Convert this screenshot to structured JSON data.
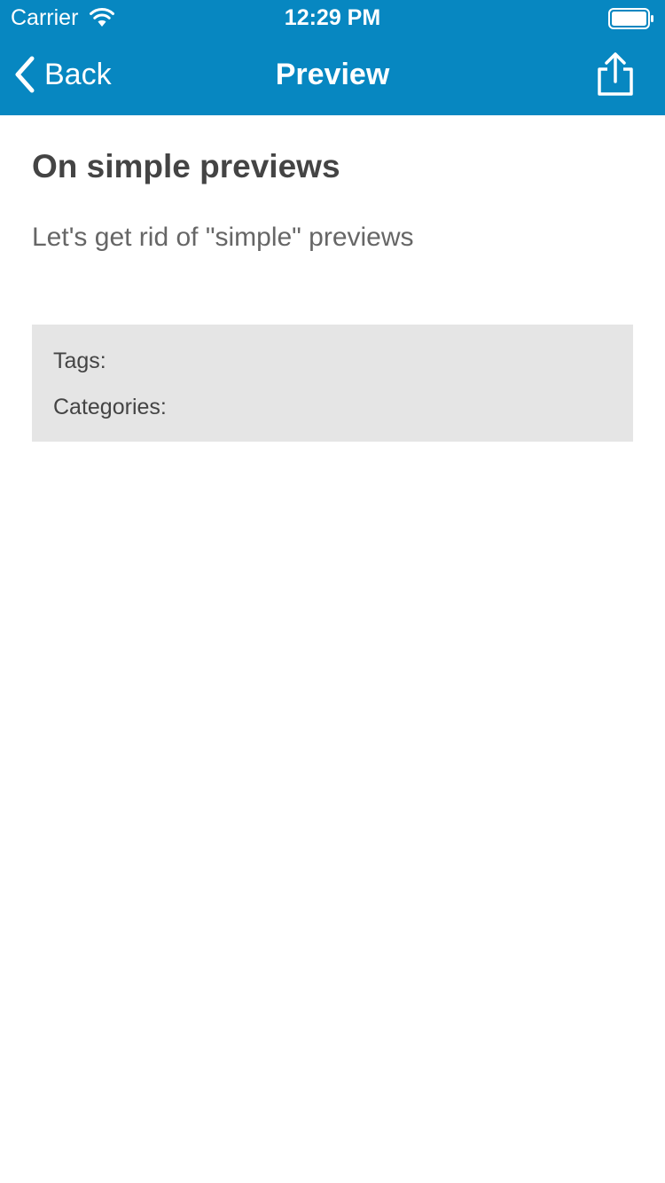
{
  "status_bar": {
    "carrier": "Carrier",
    "time": "12:29 PM",
    "wifi_icon": "wifi-icon",
    "battery_icon": "battery-icon"
  },
  "nav": {
    "back_label": "Back",
    "title": "Preview",
    "share_icon": "share-icon",
    "back_icon": "chevron-left-icon"
  },
  "post": {
    "title": "On simple previews",
    "body": "Let's get rid of \"simple\" previews"
  },
  "meta": {
    "tags_label": "Tags:",
    "categories_label": "Categories:"
  },
  "colors": {
    "header_background": "#0787c1",
    "meta_background": "#e5e5e5",
    "title_text": "#444444",
    "body_text": "#666666"
  }
}
